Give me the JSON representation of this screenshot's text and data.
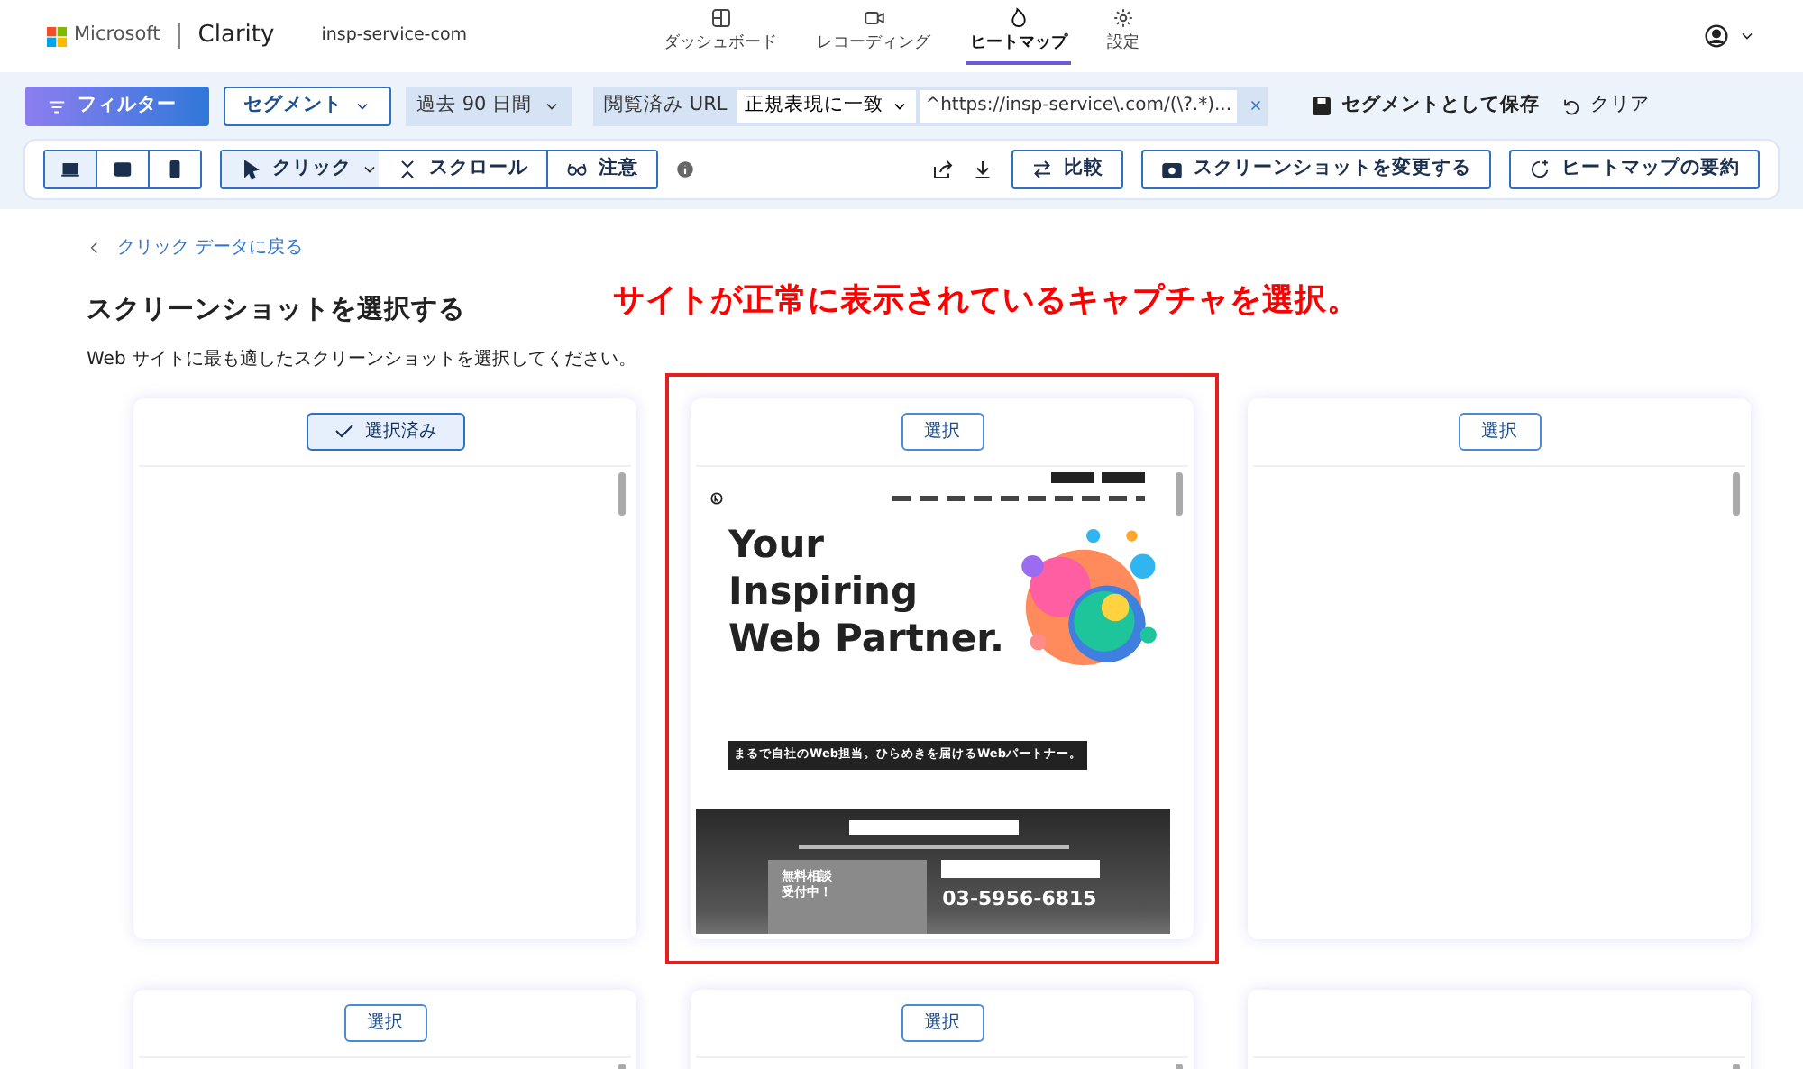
{
  "header": {
    "brand": "Microsoft",
    "product": "Clarity",
    "project": "insp-service-com",
    "nav": [
      {
        "label": "ダッシュボード",
        "selected": false
      },
      {
        "label": "レコーディング",
        "selected": false
      },
      {
        "label": "ヒートマップ",
        "selected": true
      },
      {
        "label": "設定",
        "selected": false
      }
    ]
  },
  "filter_bar": {
    "filter_button": "フィルター",
    "segment_button": "セグメント",
    "date_range": "過去 90 日間",
    "url_filter": {
      "label": "閲覧済み URL",
      "match": "正規表現に一致",
      "value": "^https://insp-service\\.com/(\\?.*)..."
    },
    "save_segment": "セグメントとして保存",
    "clear": "クリア"
  },
  "view_toolbar": {
    "devices": [
      {
        "kind": "desktop",
        "selected": true
      },
      {
        "kind": "tablet",
        "selected": false
      },
      {
        "kind": "phone",
        "selected": false
      }
    ],
    "modes": [
      {
        "label": "クリック",
        "selected": true
      },
      {
        "label": "スクロール",
        "selected": false
      },
      {
        "label": "注意",
        "selected": false
      }
    ],
    "compare": "比較",
    "change_screenshot": "スクリーンショットを変更する",
    "summary": "ヒートマップの要約"
  },
  "content": {
    "back_link": "クリック データに戻る",
    "title": "スクリーンショットを選択する",
    "annotation": "サイトが正常に表示されているキャプチャを選択。",
    "subtitle": "Web サイトに最も適したスクリーンショットを選択してください。",
    "cards": [
      {
        "kind": "blank",
        "button": "選択済み",
        "selected": true,
        "highlighted": false
      },
      {
        "kind": "site",
        "button": "選択",
        "selected": false,
        "highlighted": true
      },
      {
        "kind": "blank",
        "button": "選択",
        "selected": false,
        "highlighted": false
      },
      {
        "kind": "blank",
        "button": "選択",
        "selected": false,
        "highlighted": false
      },
      {
        "kind": "blank",
        "button": "選択",
        "selected": false,
        "highlighted": false
      },
      {
        "kind": "blank",
        "highlighted": false
      }
    ],
    "site_preview": {
      "headline": [
        "Your",
        "Inspiring",
        "Web Partner."
      ],
      "tagline": "まるで自社のWeb担当。ひらめきを届けるWebパートナー。",
      "photo_caption": [
        "無料相談",
        "受付中！"
      ],
      "phone": "03-5956-6815"
    }
  }
}
